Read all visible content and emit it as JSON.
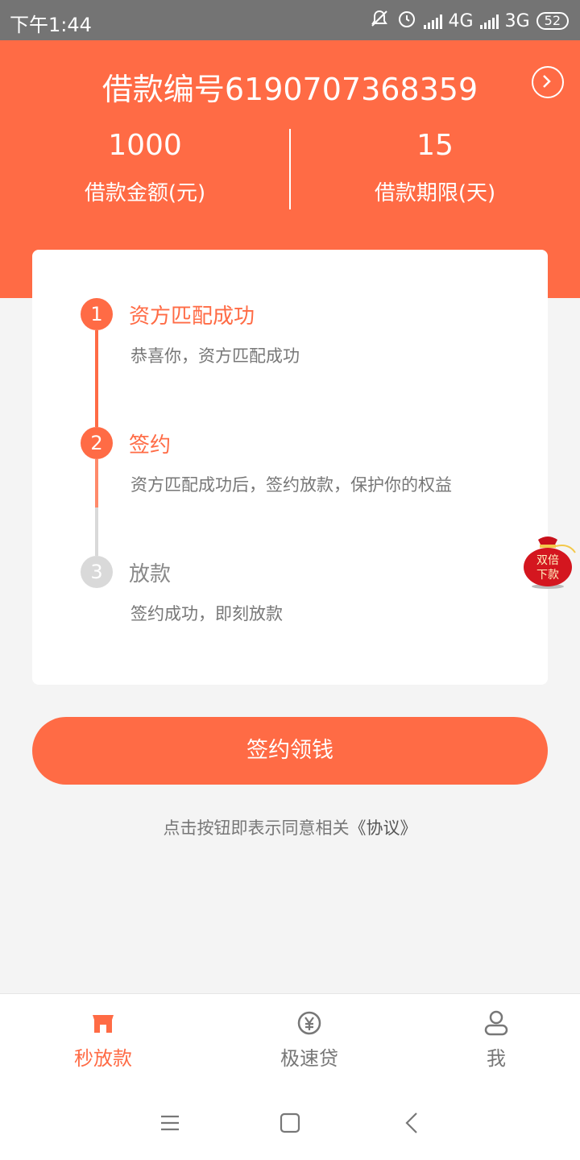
{
  "status_bar": {
    "time": "下午1:44",
    "network1": "4G",
    "network2": "3G",
    "battery": "52"
  },
  "header": {
    "loan_number": "借款编号6190707368359",
    "amount_value": "1000",
    "amount_label": "借款金额(元)",
    "term_value": "15",
    "term_label": "借款期限(天)"
  },
  "steps": [
    {
      "num": "1",
      "title": "资方匹配成功",
      "desc": "恭喜你，资方匹配成功",
      "state": "done"
    },
    {
      "num": "2",
      "title": "签约",
      "desc": "资方匹配成功后，签约放款，保护你的权益",
      "state": "current"
    },
    {
      "num": "3",
      "title": "放款",
      "desc": "签约成功，即刻放款",
      "state": "pending"
    }
  ],
  "badge": {
    "text_line1": "双倍",
    "text_line2": "下款"
  },
  "sign_button": {
    "label": "签约领钱"
  },
  "agreement": {
    "prefix": "点击按钮即表示同意相关",
    "link": "《协议》"
  },
  "tabs": [
    {
      "label": "秒放款",
      "icon": "shop-icon",
      "active": true
    },
    {
      "label": "极速贷",
      "icon": "yen-coin-icon",
      "active": false
    },
    {
      "label": "我",
      "icon": "person-icon",
      "active": false
    }
  ],
  "colors": {
    "accent": "#ff6b45",
    "status_bar": "#747474",
    "background": "#f4f4f4"
  }
}
